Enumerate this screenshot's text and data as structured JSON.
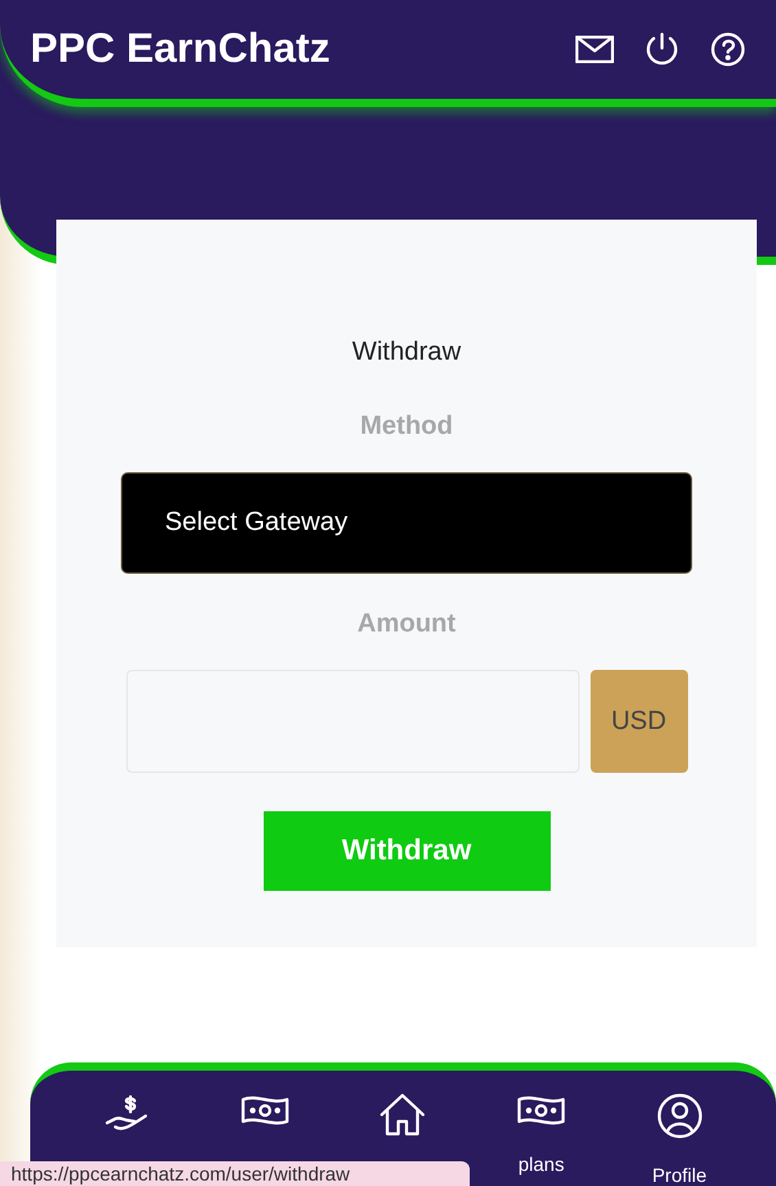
{
  "header": {
    "title": "PPC EarnChatz"
  },
  "form": {
    "title": "Withdraw",
    "method_label": "Method",
    "gateway_select": {
      "value": "Select Gateway"
    },
    "amount_label": "Amount",
    "amount_field": {
      "currency": "USD"
    },
    "submit": "Withdraw"
  },
  "bottom_nav": [
    {
      "kind": "deposit"
    },
    {
      "kind": "cash"
    },
    {
      "kind": "home"
    },
    {
      "kind": "cash",
      "label": "plans"
    },
    {
      "kind": "profile",
      "label": "Profile"
    }
  ],
  "status_url": "https://ppcearnchatz.com/user/withdraw"
}
